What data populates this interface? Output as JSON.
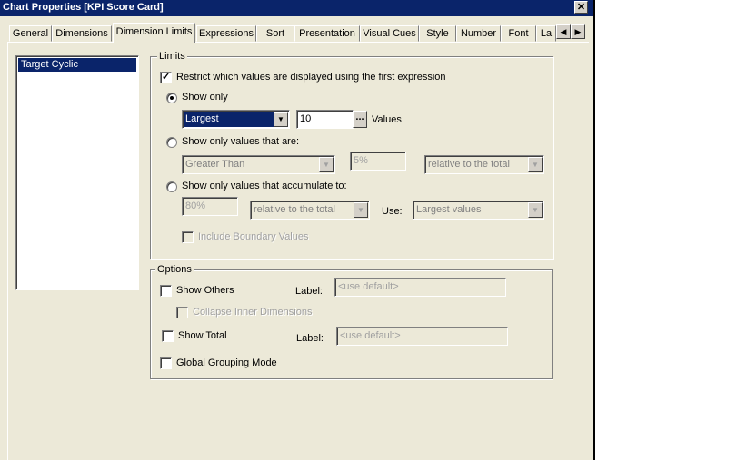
{
  "window": {
    "title": "Chart Properties [KPI Score Card]"
  },
  "icons": {
    "close": "close-icon",
    "scroll_left": "triangle-left-icon",
    "scroll_right": "triangle-right-icon",
    "dropdown": "chevron-down-icon",
    "check": "check-icon"
  },
  "glyphs": {
    "close": "✕",
    "left": "◀",
    "right": "▶",
    "down": "▼",
    "check": "✓",
    "ellipsis": "..."
  },
  "tabs": [
    {
      "label": "General"
    },
    {
      "label": "Dimensions"
    },
    {
      "label": "Dimension Limits",
      "active": true
    },
    {
      "label": "Expressions"
    },
    {
      "label": "Sort"
    },
    {
      "label": "Presentation"
    },
    {
      "label": "Visual Cues"
    },
    {
      "label": "Style"
    },
    {
      "label": "Number"
    },
    {
      "label": "Font"
    },
    {
      "label": "La"
    }
  ],
  "dimension_list": {
    "items": [
      "Target Cyclic"
    ],
    "selected": "Target Cyclic"
  },
  "limits": {
    "title": "Limits",
    "restrict_label": "Restrict which values are displayed using the first expression",
    "restrict_checked": true,
    "show_only": {
      "label": "Show only",
      "selected": true,
      "mode_value": "Largest",
      "count_value": "10",
      "values_label": "Values"
    },
    "show_only_values": {
      "label": "Show only values that are:",
      "selected": false,
      "comparison_value": "Greater Than",
      "percent_value": "5%",
      "relative_value": "relative to the total"
    },
    "accumulate": {
      "label": "Show only values that accumulate to:",
      "selected": false,
      "percent_value": "80%",
      "relative_value": "relative to the total",
      "use_label": "Use:",
      "use_value": "Largest values"
    },
    "include_boundary_label": "Include Boundary Values",
    "include_boundary_checked": false
  },
  "options": {
    "title": "Options",
    "show_others_label": "Show Others",
    "show_others_checked": false,
    "others_label_label": "Label:",
    "others_label_placeholder": "<use default>",
    "collapse_label": "Collapse Inner Dimensions",
    "collapse_checked": false,
    "show_total_label": "Show Total",
    "show_total_checked": false,
    "total_label_label": "Label:",
    "total_label_placeholder": "<use default>",
    "global_grouping_label": "Global Grouping Mode",
    "global_grouping_checked": false
  },
  "colors": {
    "titlebar": "#0a246a",
    "dialog": "#ece9d8",
    "selection": "#0a246a"
  }
}
